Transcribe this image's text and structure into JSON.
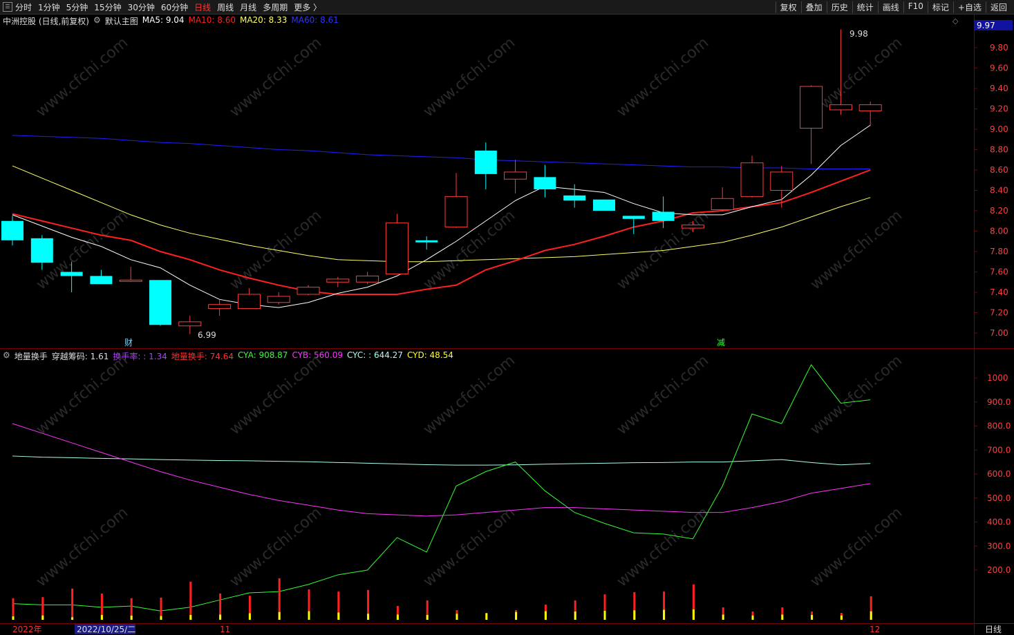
{
  "toolbar": {
    "tabs": [
      {
        "label": "分时",
        "active": false
      },
      {
        "label": "1分钟",
        "active": false
      },
      {
        "label": "5分钟",
        "active": false
      },
      {
        "label": "15分钟",
        "active": false
      },
      {
        "label": "30分钟",
        "active": false
      },
      {
        "label": "60分钟",
        "active": false
      },
      {
        "label": "日线",
        "active": true
      },
      {
        "label": "周线",
        "active": false
      },
      {
        "label": "月线",
        "active": false
      },
      {
        "label": "多周期",
        "active": false
      },
      {
        "label": "更多 〉",
        "active": false
      }
    ],
    "right_buttons": [
      "复权",
      "叠加",
      "历史",
      "统计",
      "画线",
      "F10",
      "标记",
      "+自选",
      "返回"
    ]
  },
  "main_header": {
    "stock": "中洲控股 (日线,前复权)",
    "template": "默认主图",
    "ma5": "MA5: 9.04",
    "ma10": "MA10: 8.60",
    "ma20": "MA20: 8.33",
    "ma60": "MA60: 8.61"
  },
  "price_axis": {
    "current": "9.97",
    "ticks": [
      "9.80",
      "9.60",
      "9.40",
      "9.20",
      "9.00",
      "8.80",
      "8.60",
      "8.40",
      "8.20",
      "8.00",
      "7.80",
      "7.60",
      "7.40",
      "7.20",
      "7.00"
    ]
  },
  "annotations": {
    "high": "9.98",
    "low": "6.99",
    "mark1": "财",
    "mark2": "减"
  },
  "sub_header": {
    "name": "地量换手",
    "chip": "穿越筹码: 1.61",
    "turnover": "换手率: : 1.34",
    "low_volume": "地量换手: 74.64",
    "cya": "CYA: 908.87",
    "cyb": "CYB: 560.09",
    "cyc": "CYC: : 644.27",
    "cyd": "CYD: 48.54"
  },
  "sub_axis": {
    "ticks": [
      "1000",
      "900.0",
      "800.0",
      "700.0",
      "600.0",
      "500.0",
      "400.0",
      "300.0",
      "200.0"
    ]
  },
  "date_axis": {
    "labels": [
      "2022年",
      "2022/10/25/二",
      "11",
      "12"
    ]
  },
  "bottom_tab": "日线",
  "watermark": "www.cfchi.com",
  "colors": {
    "up": "#ff3c3c",
    "down": "#00ffff",
    "ma5": "#ffffff",
    "ma10": "#ff2020",
    "ma20": "#ffff66",
    "ma60": "#2020ff",
    "cya": "#33ff33",
    "cyb": "#ff33ff",
    "cyc": "#aaffee",
    "vol": "#ff2020",
    "yellow": "#ffff00"
  },
  "chart_data": {
    "type": "candlestick",
    "candles": [
      {
        "o": 8.1,
        "h": 8.15,
        "l": 7.86,
        "c": 7.91
      },
      {
        "o": 7.93,
        "h": 7.96,
        "l": 7.62,
        "c": 7.69
      },
      {
        "o": 7.6,
        "h": 7.7,
        "l": 7.4,
        "c": 7.56
      },
      {
        "o": 7.56,
        "h": 7.62,
        "l": 7.48,
        "c": 7.48
      },
      {
        "o": 7.52,
        "h": 7.65,
        "l": 7.5,
        "c": 7.52
      },
      {
        "o": 7.52,
        "h": 7.52,
        "l": 7.07,
        "c": 7.08
      },
      {
        "o": 7.07,
        "h": 7.17,
        "l": 6.99,
        "c": 7.11
      },
      {
        "o": 7.24,
        "h": 7.33,
        "l": 7.17,
        "c": 7.28
      },
      {
        "o": 7.24,
        "h": 7.44,
        "l": 7.24,
        "c": 7.38
      },
      {
        "o": 7.3,
        "h": 7.4,
        "l": 7.28,
        "c": 7.36
      },
      {
        "o": 7.38,
        "h": 7.47,
        "l": 7.37,
        "c": 7.45
      },
      {
        "o": 7.5,
        "h": 7.55,
        "l": 7.45,
        "c": 7.53
      },
      {
        "o": 7.5,
        "h": 7.6,
        "l": 7.48,
        "c": 7.56
      },
      {
        "o": 7.58,
        "h": 8.17,
        "l": 7.58,
        "c": 8.08
      },
      {
        "o": 7.91,
        "h": 7.95,
        "l": 7.82,
        "c": 7.89
      },
      {
        "o": 8.04,
        "h": 8.57,
        "l": 8.03,
        "c": 8.34
      },
      {
        "o": 8.79,
        "h": 8.87,
        "l": 8.41,
        "c": 8.56
      },
      {
        "o": 8.51,
        "h": 8.7,
        "l": 8.37,
        "c": 8.58
      },
      {
        "o": 8.53,
        "h": 8.65,
        "l": 8.33,
        "c": 8.41
      },
      {
        "o": 8.35,
        "h": 8.46,
        "l": 8.23,
        "c": 8.3
      },
      {
        "o": 8.31,
        "h": 8.31,
        "l": 8.2,
        "c": 8.2
      },
      {
        "o": 8.15,
        "h": 8.15,
        "l": 7.97,
        "c": 8.12
      },
      {
        "o": 8.19,
        "h": 8.34,
        "l": 8.03,
        "c": 8.1
      },
      {
        "o": 8.03,
        "h": 8.1,
        "l": 7.99,
        "c": 8.06
      },
      {
        "o": 8.21,
        "h": 8.43,
        "l": 8.2,
        "c": 8.32
      },
      {
        "o": 8.34,
        "h": 8.74,
        "l": 8.33,
        "c": 8.67
      },
      {
        "o": 8.4,
        "h": 8.64,
        "l": 8.23,
        "c": 8.58
      },
      {
        "o": 9.01,
        "h": 9.43,
        "l": 8.66,
        "c": 9.42
      },
      {
        "o": 9.19,
        "h": 9.98,
        "l": 9.14,
        "c": 9.24
      },
      {
        "o": 9.18,
        "h": 9.27,
        "l": 9.03,
        "c": 9.24
      }
    ],
    "ma5": [
      8.16,
      8.05,
      7.94,
      7.85,
      7.72,
      7.64,
      7.47,
      7.33,
      7.28,
      7.25,
      7.3,
      7.39,
      7.45,
      7.56,
      7.72,
      7.9,
      8.1,
      8.3,
      8.44,
      8.41,
      8.38,
      8.27,
      8.18,
      8.16,
      8.16,
      8.24,
      8.31,
      8.55,
      8.84,
      9.04
    ],
    "ma10": [
      8.17,
      8.1,
      8.03,
      7.96,
      7.91,
      7.8,
      7.72,
      7.62,
      7.54,
      7.47,
      7.41,
      7.38,
      7.38,
      7.38,
      7.43,
      7.47,
      7.62,
      7.71,
      7.81,
      7.87,
      7.95,
      8.04,
      8.1,
      8.18,
      8.2,
      8.24,
      8.28,
      8.38,
      8.49,
      8.6
    ],
    "ma20": [
      8.64,
      8.52,
      8.4,
      8.28,
      8.16,
      8.06,
      7.98,
      7.92,
      7.86,
      7.81,
      7.76,
      7.72,
      7.71,
      7.7,
      7.7,
      7.71,
      7.72,
      7.73,
      7.74,
      7.75,
      7.77,
      7.79,
      7.81,
      7.85,
      7.89,
      7.96,
      8.04,
      8.14,
      8.24,
      8.33
    ],
    "ma60": [
      8.94,
      8.93,
      8.92,
      8.91,
      8.89,
      8.87,
      8.86,
      8.84,
      8.82,
      8.8,
      8.79,
      8.77,
      8.75,
      8.74,
      8.73,
      8.72,
      8.7,
      8.69,
      8.68,
      8.67,
      8.66,
      8.65,
      8.64,
      8.63,
      8.63,
      8.62,
      8.62,
      8.61,
      8.61,
      8.61
    ],
    "cya": [
      60,
      55,
      55,
      45,
      50,
      30,
      45,
      75,
      105,
      110,
      140,
      180,
      200,
      335,
      275,
      550,
      610,
      650,
      530,
      440,
      395,
      355,
      350,
      330,
      550,
      850,
      810,
      1055,
      895,
      909
    ],
    "cyb": [
      810,
      770,
      730,
      690,
      650,
      610,
      575,
      545,
      515,
      490,
      470,
      450,
      435,
      430,
      425,
      430,
      440,
      450,
      460,
      460,
      455,
      450,
      445,
      440,
      440,
      460,
      485,
      520,
      540,
      560
    ],
    "cyc": [
      675,
      670,
      668,
      665,
      663,
      660,
      658,
      656,
      655,
      653,
      651,
      648,
      645,
      642,
      639,
      637,
      637,
      638,
      641,
      643,
      645,
      647,
      648,
      650,
      650,
      655,
      660,
      648,
      638,
      644
    ],
    "vol": [
      78,
      82,
      113,
      95,
      78,
      80,
      138,
      95,
      87,
      150,
      110,
      102,
      108,
      50,
      70,
      35,
      25,
      35,
      55,
      70,
      92,
      100,
      102,
      128,
      45,
      30,
      45,
      30,
      25,
      85
    ],
    "cyd": [
      20,
      25,
      15,
      28,
      24,
      22,
      28,
      30,
      38,
      45,
      50,
      42,
      35,
      30,
      28,
      35,
      38,
      45,
      50,
      48,
      52,
      55,
      58,
      60,
      30,
      25,
      30,
      28,
      25,
      49
    ]
  }
}
